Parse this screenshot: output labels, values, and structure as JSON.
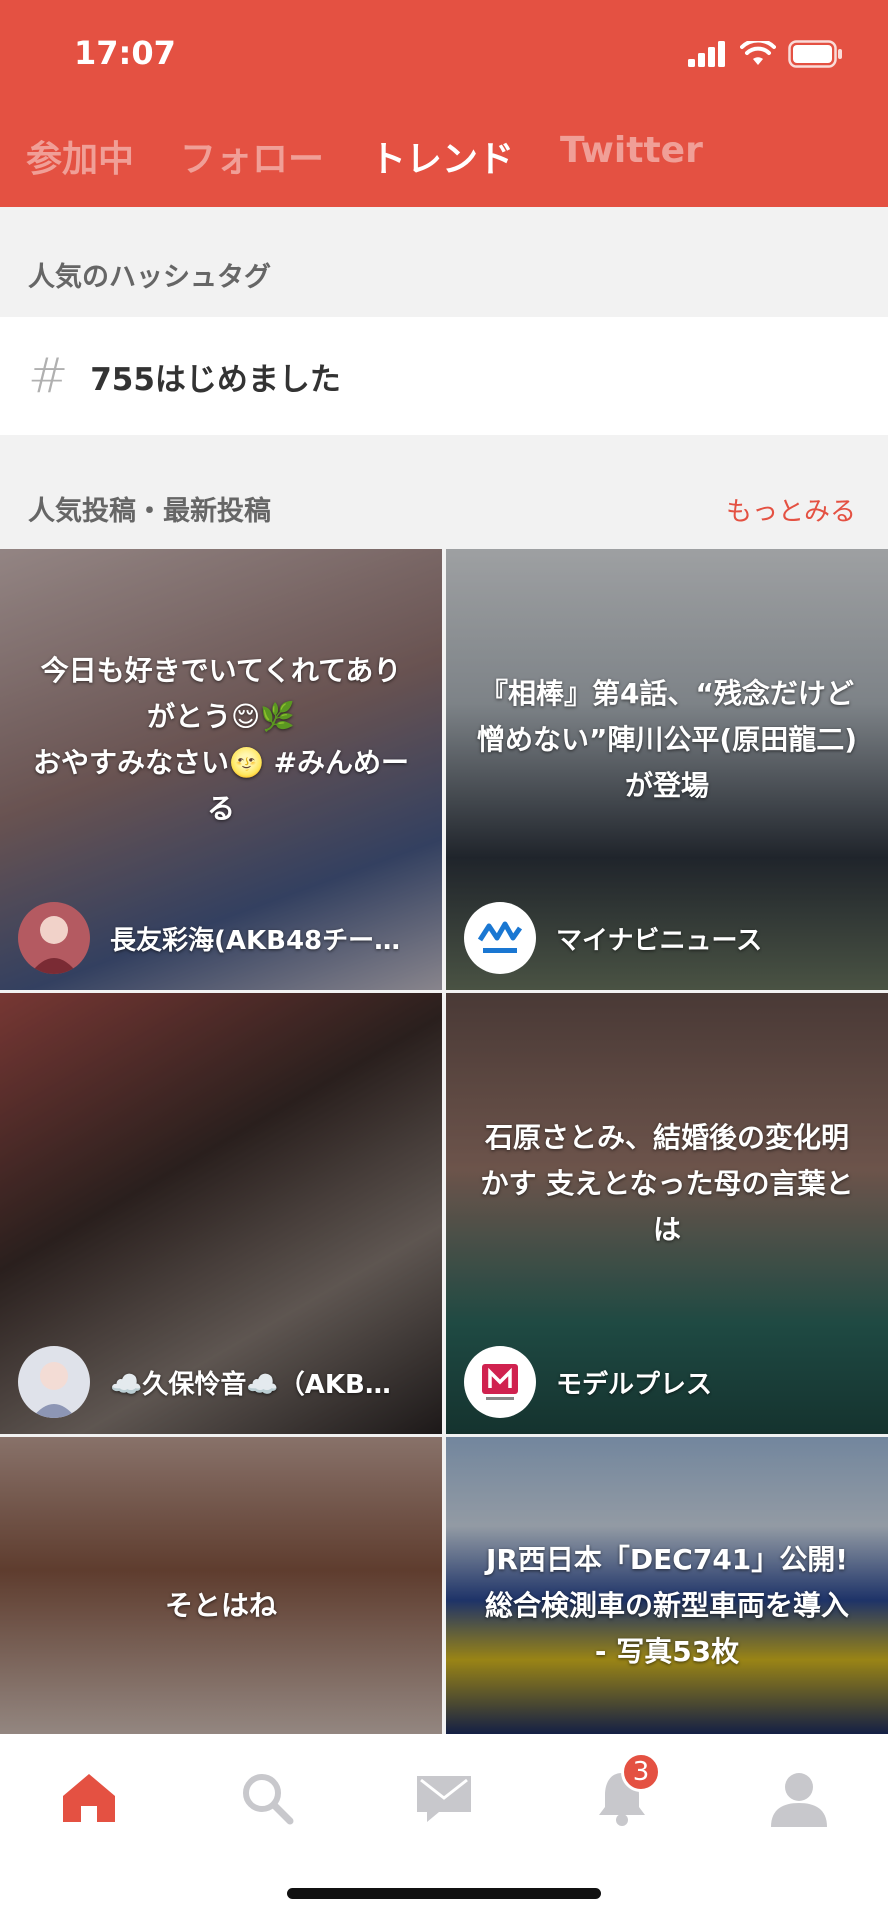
{
  "status_bar": {
    "time": "17:07"
  },
  "tabs": [
    {
      "label": "参加中",
      "active": false
    },
    {
      "label": "フォロー",
      "active": false
    },
    {
      "label": "トレンド",
      "active": true
    },
    {
      "label": "Twitter",
      "active": false
    }
  ],
  "hashtags": {
    "section_title": "人気のハッシュタグ",
    "items": [
      {
        "symbol": "#",
        "text": "755はじめました"
      }
    ]
  },
  "posts": {
    "section_title": "人気投稿・最新投稿",
    "more_label": "もっとみる",
    "items": [
      {
        "caption": "今日も好きでいてくれてありがとう😌🌿\nおやすみなさい🌝 #みんめーる",
        "author": "長友彩海(AKB48チー…"
      },
      {
        "caption": "『相棒』第4話、“残念だけど憎めない”陣川公平(原田龍二)が登場",
        "author": "マイナビニュース"
      },
      {
        "caption": "",
        "author": "☁️久保怜音☁️（AKB…"
      },
      {
        "caption": "石原さとみ、結婚後の変化明かす 支えとなった母の言葉とは",
        "author": "モデルプレス"
      },
      {
        "caption": "そとはね",
        "author": ""
      },
      {
        "caption": "JR西日本「DEC741」公開! 総合検測車の新型車両を導入 - 写真53枚",
        "author": ""
      }
    ]
  },
  "bottom_nav": {
    "items": [
      {
        "icon": "home-icon",
        "active": true
      },
      {
        "icon": "search-icon",
        "active": false
      },
      {
        "icon": "mail-icon",
        "active": false
      },
      {
        "icon": "bell-icon",
        "active": false,
        "badge": "3"
      },
      {
        "icon": "profile-icon",
        "active": false
      }
    ]
  },
  "colors": {
    "accent": "#e45142",
    "inactive_icon": "#c8c8cc"
  }
}
